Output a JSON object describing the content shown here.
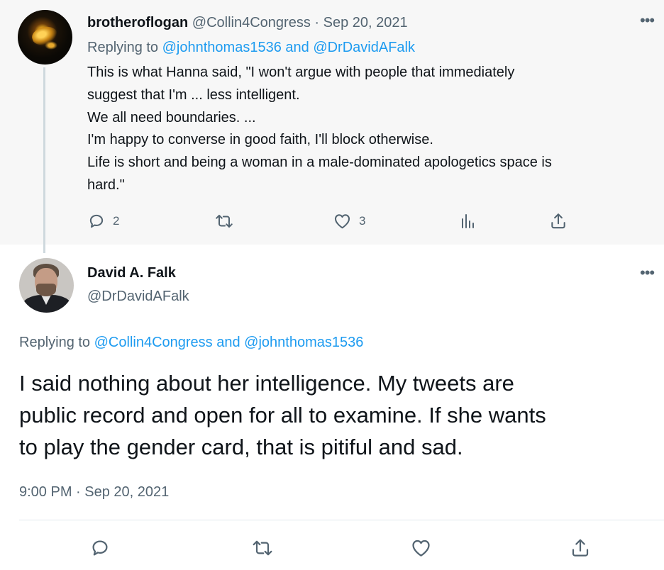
{
  "parent_tweet": {
    "display_name": "brotheroflogan",
    "handle": "@Collin4Congress",
    "separator": " · ",
    "date": "Sep 20, 2021",
    "more_icon": "ellipsis-icon",
    "replying_prefix": "Replying to ",
    "replying_mention_1": "@johnthomas1536",
    "replying_and": " and ",
    "replying_mention_2": "@DrDavidAFalk",
    "body_lines": [
      "This is what Hanna said, \"I won't argue with people that immediately",
      "suggest that I'm ... less intelligent.",
      "We all need boundaries. ...",
      "I'm happy to converse in good faith, I'll block otherwise.",
      "Life is short and being a woman in a male-dominated apologetics space is",
      "hard.\""
    ],
    "actions": {
      "reply_count": "2",
      "like_count": "3"
    }
  },
  "main_tweet": {
    "display_name": "David A. Falk",
    "handle": "@DrDavidAFalk",
    "more_icon": "ellipsis-icon",
    "replying_prefix": "Replying to ",
    "replying_mention_1": "@Collin4Congress",
    "replying_and": " and ",
    "replying_mention_2": "@johnthomas1536",
    "body_lines": [
      "I said nothing about her intelligence.  My tweets are",
      "public record and open for all to examine.  If she wants",
      "to play the gender card, that is pitiful and sad."
    ],
    "timestamp": "9:00 PM · Sep 20, 2021"
  },
  "colors": {
    "text_primary": "#0f1419",
    "text_secondary": "#536471",
    "link": "#1d9bf0",
    "parent_background": "#f7f7f7",
    "thread_line": "#cfd9de"
  }
}
